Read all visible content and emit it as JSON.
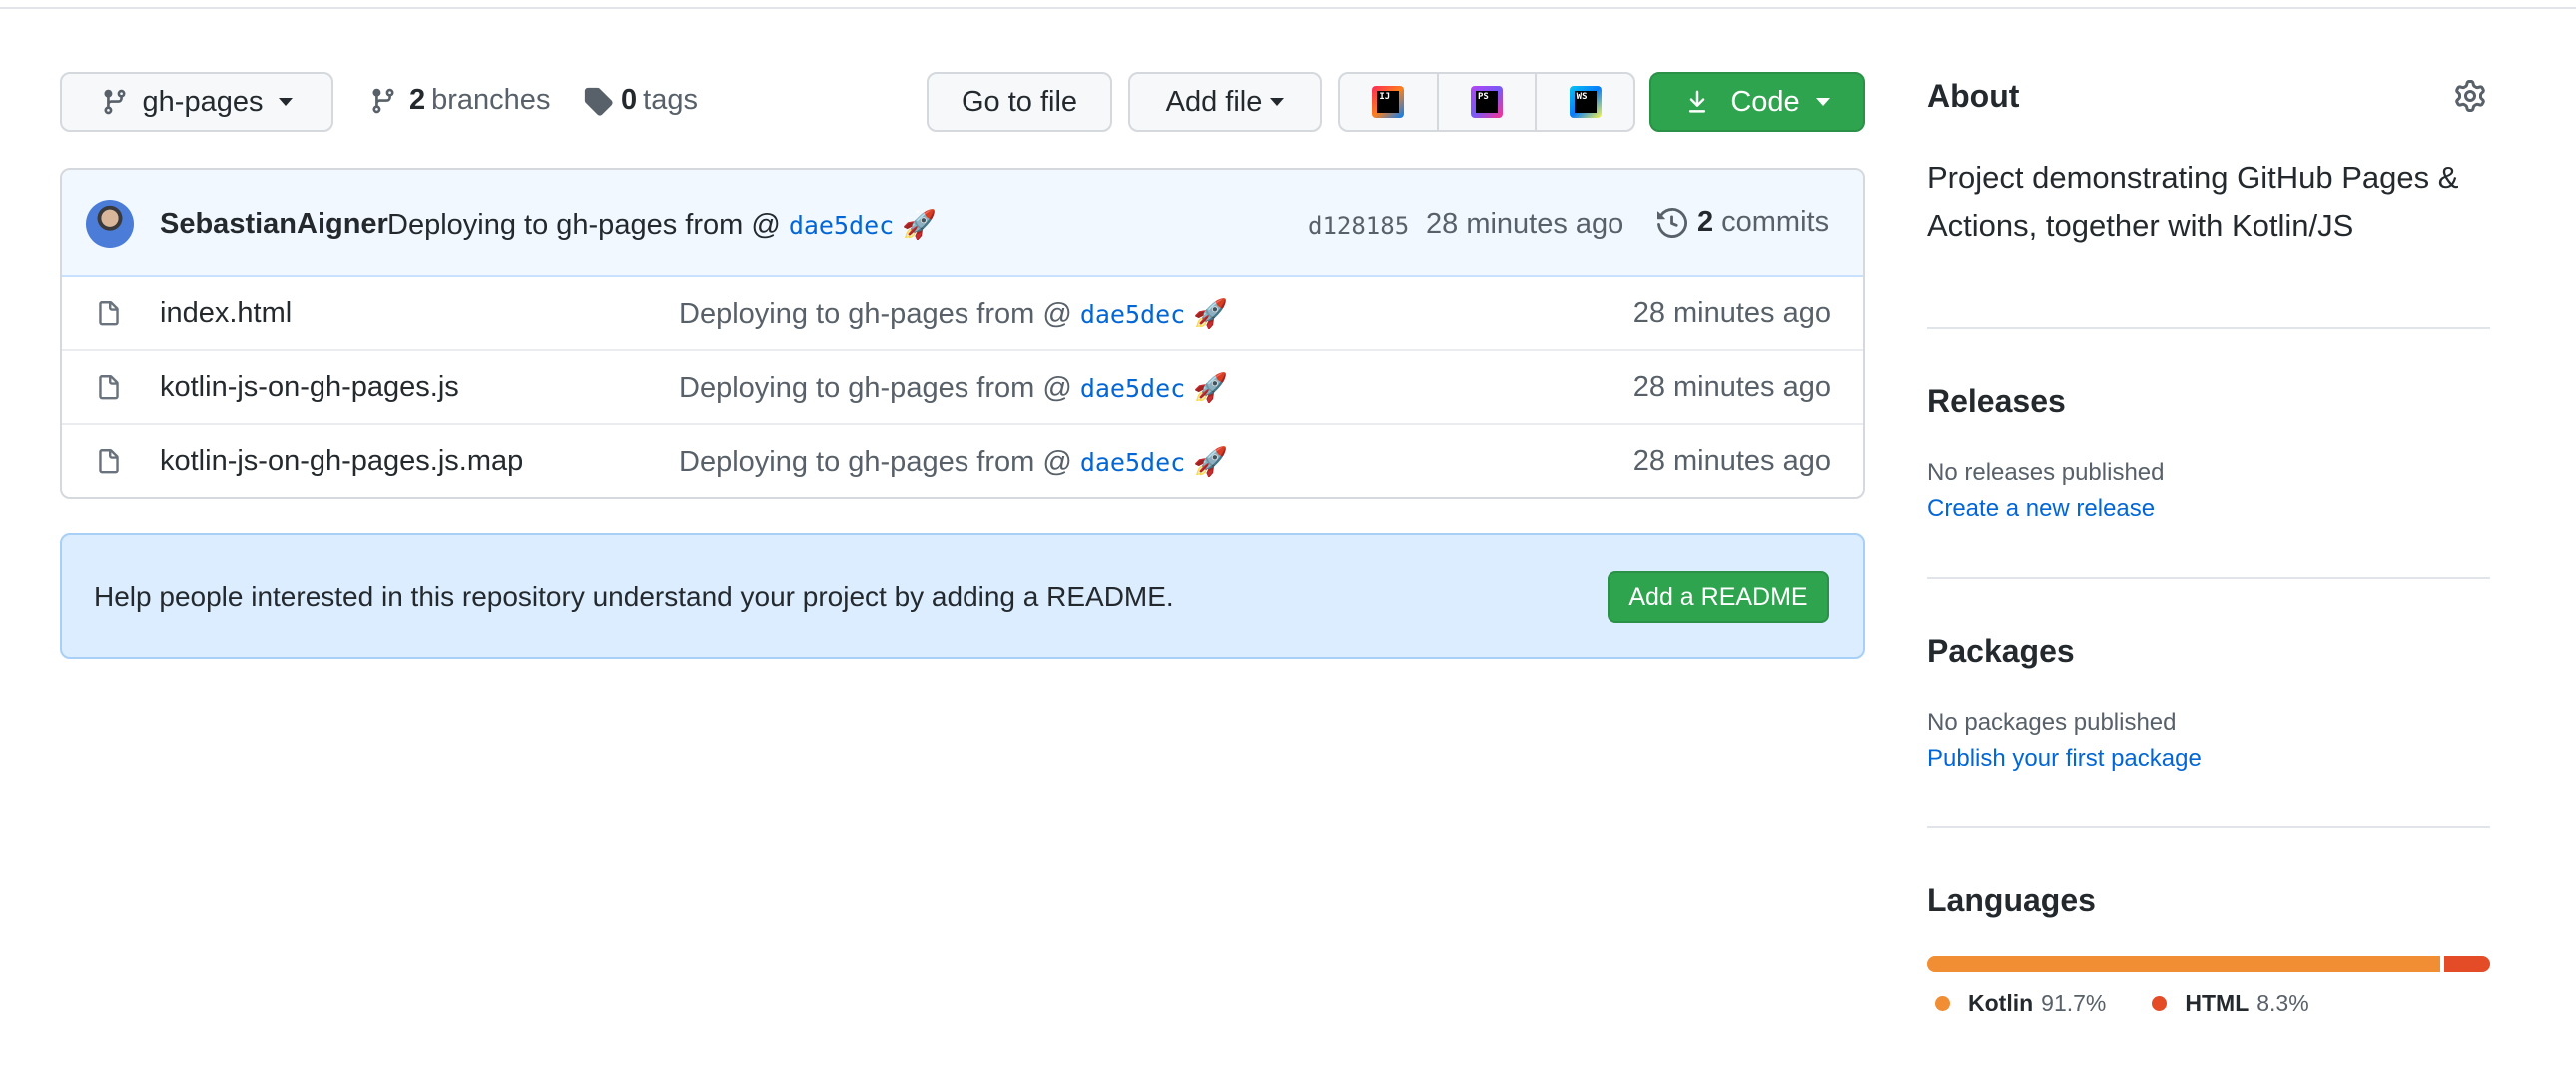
{
  "toolbar": {
    "branch": "gh-pages",
    "branches_count": "2",
    "branches_label": "branches",
    "tags_count": "0",
    "tags_label": "tags",
    "go_to_file": "Go to file",
    "add_file": "Add file",
    "ide_icons": [
      {
        "icon": "intellij-icon",
        "text": "IJ"
      },
      {
        "icon": "phpstorm-icon",
        "text": "PS"
      },
      {
        "icon": "webstorm-icon",
        "text": "WS"
      }
    ],
    "code": "Code"
  },
  "latest_commit": {
    "author": "SebastianAigner",
    "message": "Deploying to gh-pages from @",
    "ref": "dae5dec",
    "emoji": "🚀",
    "sha": "d128185",
    "time": "28 minutes ago",
    "commits_count": "2",
    "commits_label": "commits"
  },
  "files": [
    {
      "name": "index.html",
      "message": "Deploying to gh-pages from @",
      "ref": "dae5dec",
      "emoji": "🚀",
      "time": "28 minutes ago"
    },
    {
      "name": "kotlin-js-on-gh-pages.js",
      "message": "Deploying to gh-pages from @",
      "ref": "dae5dec",
      "emoji": "🚀",
      "time": "28 minutes ago"
    },
    {
      "name": "kotlin-js-on-gh-pages.js.map",
      "message": "Deploying to gh-pages from @",
      "ref": "dae5dec",
      "emoji": "🚀",
      "time": "28 minutes ago"
    }
  ],
  "readme_banner": {
    "text": "Help people interested in this repository understand your project by adding a README.",
    "button": "Add a README"
  },
  "sidebar": {
    "about_title": "About",
    "about_desc": "Project demonstrating GitHub Pages & Actions, together with Kotlin/JS",
    "releases_title": "Releases",
    "releases_none": "No releases published",
    "releases_link": "Create a new release",
    "packages_title": "Packages",
    "packages_none": "No packages published",
    "packages_link": "Publish your first package",
    "languages_title": "Languages",
    "languages": [
      {
        "name": "Kotlin",
        "percent": "91.7%",
        "value": 91.7,
        "color": "#F18E33"
      },
      {
        "name": "HTML",
        "percent": "8.3%",
        "value": 8.3,
        "color": "#E34C26"
      }
    ]
  },
  "colors": {
    "primary_green": "#2ea44f",
    "link_blue": "#0366d6",
    "commit_header_bg": "#f1f8ff",
    "readme_banner_bg": "#dbedff"
  }
}
